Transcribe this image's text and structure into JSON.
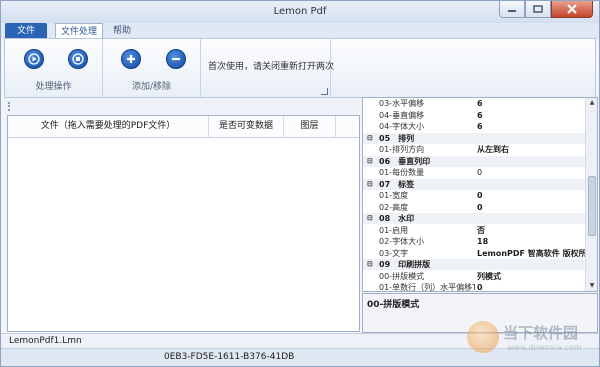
{
  "window": {
    "title": "Lemon Pdf"
  },
  "tabs": {
    "file": "文件",
    "processing": "文件处理",
    "help": "帮助"
  },
  "ribbon": {
    "groups": [
      {
        "label": "处理操作",
        "buttons": [
          "play-icon",
          "stop-icon"
        ]
      },
      {
        "label": "添加/移除",
        "buttons": [
          "plus-icon",
          "minus-icon"
        ]
      }
    ],
    "note": "首次使用，请关闭重新打开两次"
  },
  "file_table": {
    "columns": [
      "文件（拖入需要处理的PDF文件）",
      "是否可变数据",
      "图层"
    ]
  },
  "properties": {
    "rows": [
      {
        "kind": "item",
        "name": "03-水平偏移",
        "value": "6",
        "bold": true
      },
      {
        "kind": "item",
        "name": "04-垂直偏移",
        "value": "6",
        "bold": true
      },
      {
        "kind": "item",
        "name": "04-字体大小",
        "value": "6",
        "bold": true
      },
      {
        "kind": "cat",
        "name": "05　排列"
      },
      {
        "kind": "item",
        "name": "01-排列方向",
        "value": "从左到右",
        "bold": true
      },
      {
        "kind": "cat",
        "name": "06　垂直列印"
      },
      {
        "kind": "item",
        "name": "01-每份数量",
        "value": "0",
        "bold": false
      },
      {
        "kind": "cat",
        "name": "07　标签"
      },
      {
        "kind": "item",
        "name": "01-宽度",
        "value": "0",
        "bold": true
      },
      {
        "kind": "item",
        "name": "02-高度",
        "value": "0",
        "bold": true
      },
      {
        "kind": "cat",
        "name": "08　水印"
      },
      {
        "kind": "item",
        "name": "01-启用",
        "value": "否",
        "bold": true
      },
      {
        "kind": "item",
        "name": "02-字体大小",
        "value": "18",
        "bold": true
      },
      {
        "kind": "item",
        "name": "03-文字",
        "value": "LemonPDF 智高软件 版权所",
        "bold": true
      },
      {
        "kind": "cat",
        "name": "09　印刷拼版"
      },
      {
        "kind": "item",
        "name": "00-拼版模式",
        "value": "列模式",
        "bold": true
      },
      {
        "kind": "item",
        "name": "01-单数行（列）水平偏移T",
        "value": "0",
        "bold": true
      }
    ],
    "description_title": "00-拼版模式"
  },
  "status": {
    "filename": "LemonPdf1.Lmn",
    "id": "0EB3-FD5E-1611-B376-41DB"
  },
  "watermark": {
    "name": "当下软件园",
    "url": "www.downxia.com"
  }
}
